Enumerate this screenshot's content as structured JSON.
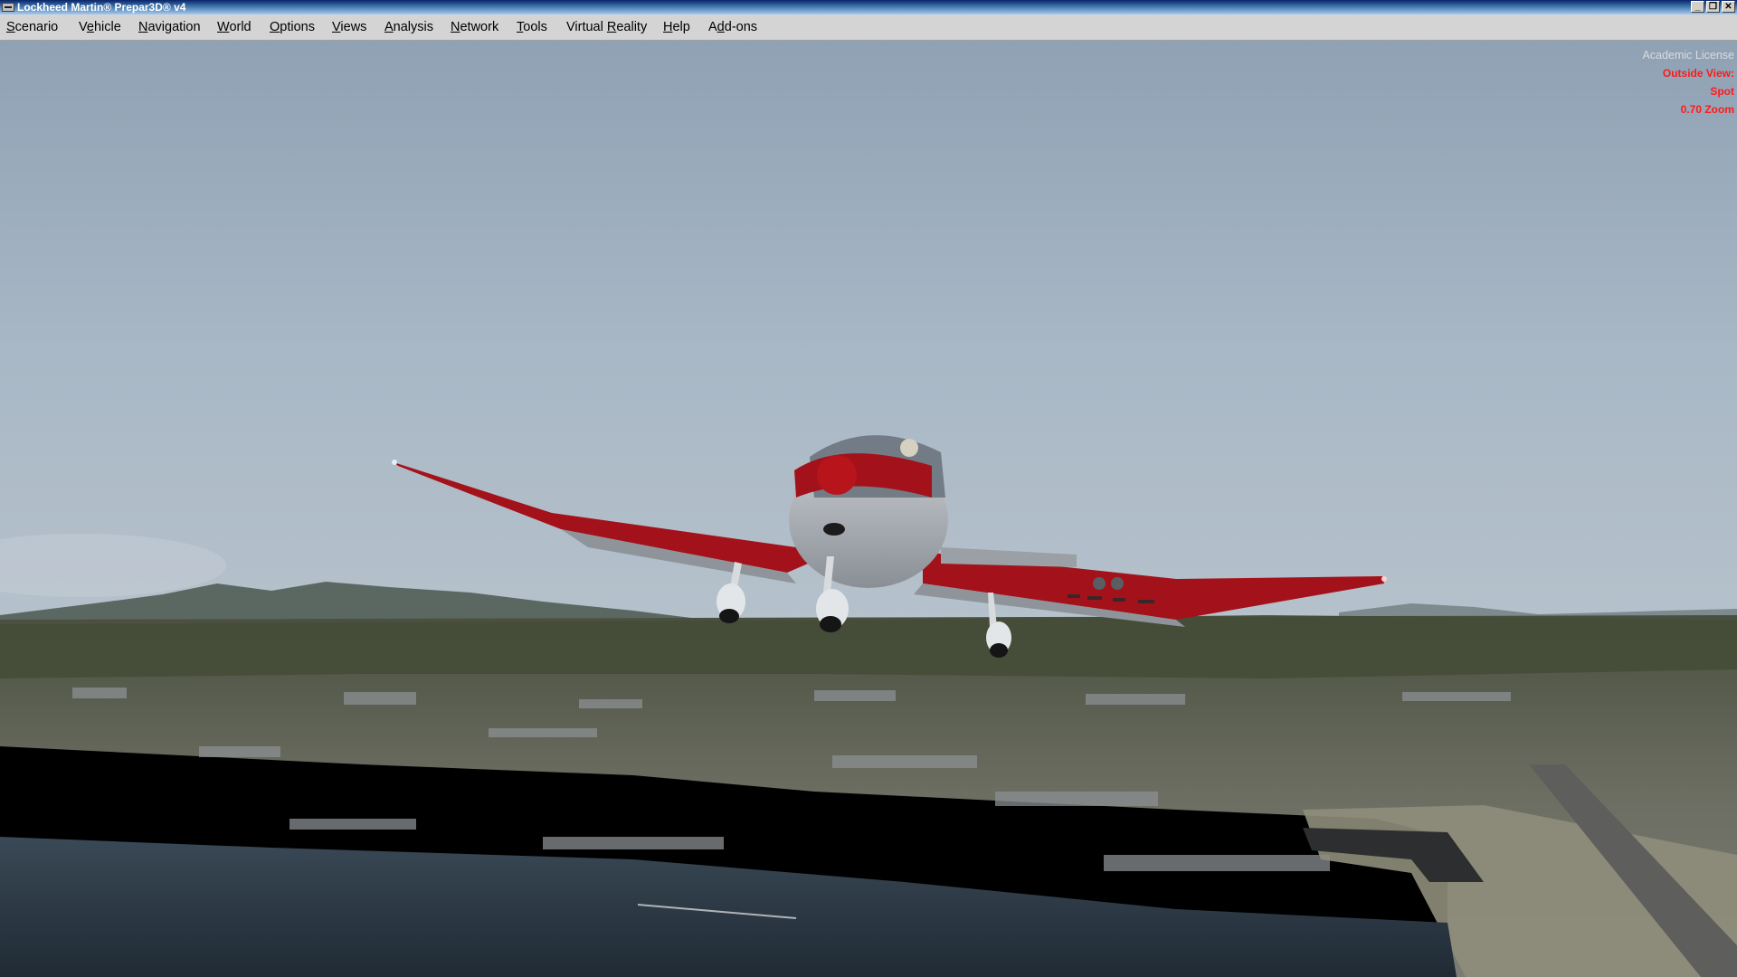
{
  "window": {
    "title": "Lockheed Martin® Prepar3D® v4",
    "buttons": {
      "minimize": "_",
      "restore": "❐",
      "close": "✕"
    }
  },
  "menu": {
    "items": [
      {
        "pre": "",
        "ul": "S",
        "post": "cenario"
      },
      {
        "pre": "V",
        "ul": "e",
        "post": "hicle"
      },
      {
        "pre": "",
        "ul": "N",
        "post": "avigation"
      },
      {
        "pre": "",
        "ul": "W",
        "post": "orld"
      },
      {
        "pre": "",
        "ul": "O",
        "post": "ptions"
      },
      {
        "pre": "",
        "ul": "V",
        "post": "iews"
      },
      {
        "pre": "",
        "ul": "A",
        "post": "nalysis"
      },
      {
        "pre": "",
        "ul": "N",
        "post": "etwork"
      },
      {
        "pre": "",
        "ul": "T",
        "post": "ools"
      },
      {
        "pre": "Virtual ",
        "ul": "R",
        "post": "eality"
      },
      {
        "pre": "",
        "ul": "H",
        "post": "elp"
      },
      {
        "pre": "A",
        "ul": "d",
        "post": "d-ons"
      }
    ]
  },
  "hud": {
    "license": "Academic License",
    "view_line1": "Outside View:",
    "view_line2": "Spot",
    "zoom": "0.70 Zoom"
  },
  "colors": {
    "hud_red": "#ff1a1a",
    "aircraft_livery": "#a3121a"
  }
}
